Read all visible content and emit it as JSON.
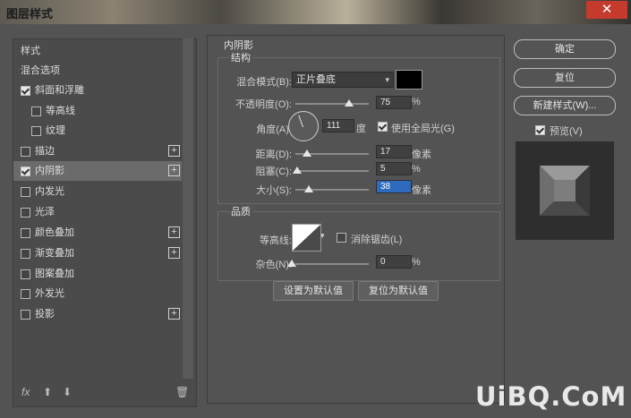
{
  "window": {
    "title": "图层样式",
    "close_glyph": "✕"
  },
  "left": {
    "items": [
      {
        "label": "样式",
        "check": false,
        "has_cb": false,
        "plus": false
      },
      {
        "label": "混合选项",
        "check": false,
        "has_cb": false,
        "plus": false
      },
      {
        "label": "斜面和浮雕",
        "check": true,
        "has_cb": true,
        "plus": false
      },
      {
        "label": "等高线",
        "check": false,
        "has_cb": true,
        "plus": false,
        "indent": true
      },
      {
        "label": "纹理",
        "check": false,
        "has_cb": true,
        "plus": false,
        "indent": true
      },
      {
        "label": "描边",
        "check": false,
        "has_cb": true,
        "plus": true
      },
      {
        "label": "内阴影",
        "check": true,
        "has_cb": true,
        "plus": true,
        "selected": true
      },
      {
        "label": "内发光",
        "check": false,
        "has_cb": true,
        "plus": false
      },
      {
        "label": "光泽",
        "check": false,
        "has_cb": true,
        "plus": false
      },
      {
        "label": "颜色叠加",
        "check": false,
        "has_cb": true,
        "plus": true
      },
      {
        "label": "渐变叠加",
        "check": false,
        "has_cb": true,
        "plus": true
      },
      {
        "label": "图案叠加",
        "check": false,
        "has_cb": true,
        "plus": false
      },
      {
        "label": "外发光",
        "check": false,
        "has_cb": true,
        "plus": false
      },
      {
        "label": "投影",
        "check": false,
        "has_cb": true,
        "plus": true
      }
    ],
    "bottom": {
      "fx": "fx",
      "up": "⬆",
      "down": "⬇",
      "trash": "🗑"
    }
  },
  "inner_shadow": {
    "section_title": "内阴影",
    "structure_title": "结构",
    "blend_mode_label": "混合模式(B):",
    "blend_mode_value": "正片叠底",
    "opacity_label": "不透明度(O):",
    "opacity_value": "75",
    "opacity_unit": "%",
    "angle_label": "角度(A):",
    "angle_value": "111",
    "angle_unit": "度",
    "global_light_label": "使用全局光(G)",
    "distance_label": "距离(D):",
    "distance_value": "17",
    "distance_unit": "像素",
    "choke_label": "阻塞(C):",
    "choke_value": "5",
    "choke_unit": "%",
    "size_label": "大小(S):",
    "size_value": "38",
    "size_unit": "像素",
    "quality_title": "品质",
    "contour_label": "等高线:",
    "antialias_label": "消除锯齿(L)",
    "noise_label": "杂色(N):",
    "noise_value": "0",
    "noise_unit": "%",
    "make_default": "设置为默认值",
    "reset_default": "复位为默认值",
    "colors": {
      "shadow": "#000000"
    }
  },
  "buttons": {
    "ok": "确定",
    "reset": "复位",
    "new_style": "新建样式(W)...",
    "preview": "预览(V)"
  },
  "watermark": "UiBQ.CoM"
}
